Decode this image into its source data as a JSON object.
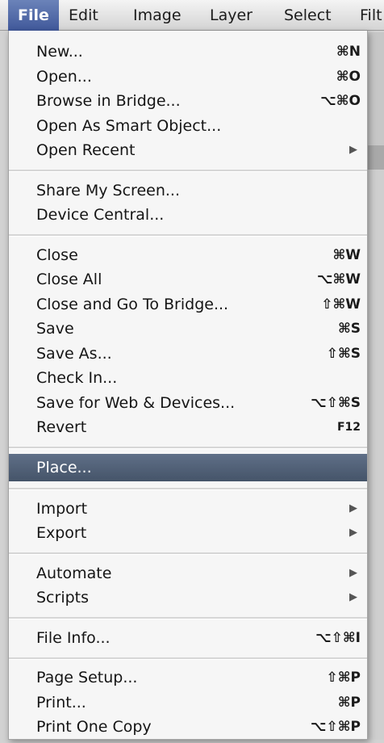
{
  "menubar": {
    "items": [
      "File",
      "Edit",
      "Image",
      "Layer",
      "Select",
      "Filt"
    ]
  },
  "menu": {
    "groups": [
      [
        {
          "label": "New...",
          "shortcut": "⌘N"
        },
        {
          "label": "Open...",
          "shortcut": "⌘O"
        },
        {
          "label": "Browse in Bridge...",
          "shortcut": "⌥⌘O"
        },
        {
          "label": "Open As Smart Object...",
          "shortcut": ""
        },
        {
          "label": "Open Recent",
          "shortcut": "",
          "submenu": true
        }
      ],
      [
        {
          "label": "Share My Screen...",
          "shortcut": ""
        },
        {
          "label": "Device Central...",
          "shortcut": ""
        }
      ],
      [
        {
          "label": "Close",
          "shortcut": "⌘W"
        },
        {
          "label": "Close All",
          "shortcut": "⌥⌘W"
        },
        {
          "label": "Close and Go To Bridge...",
          "shortcut": "⇧⌘W"
        },
        {
          "label": "Save",
          "shortcut": "⌘S"
        },
        {
          "label": "Save As...",
          "shortcut": "⇧⌘S"
        },
        {
          "label": "Check In...",
          "shortcut": ""
        },
        {
          "label": "Save for Web & Devices...",
          "shortcut": "⌥⇧⌘S"
        },
        {
          "label": "Revert",
          "shortcut": "F12"
        }
      ],
      [
        {
          "label": "Place...",
          "shortcut": "",
          "highlighted": true
        }
      ],
      [
        {
          "label": "Import",
          "shortcut": "",
          "submenu": true
        },
        {
          "label": "Export",
          "shortcut": "",
          "submenu": true
        }
      ],
      [
        {
          "label": "Automate",
          "shortcut": "",
          "submenu": true
        },
        {
          "label": "Scripts",
          "shortcut": "",
          "submenu": true
        }
      ],
      [
        {
          "label": "File Info...",
          "shortcut": "⌥⇧⌘I"
        }
      ],
      [
        {
          "label": "Page Setup...",
          "shortcut": "⇧⌘P"
        },
        {
          "label": "Print...",
          "shortcut": "⌘P"
        },
        {
          "label": "Print One Copy",
          "shortcut": "⌥⇧⌘P"
        }
      ]
    ],
    "submenu_glyph": "▶"
  }
}
